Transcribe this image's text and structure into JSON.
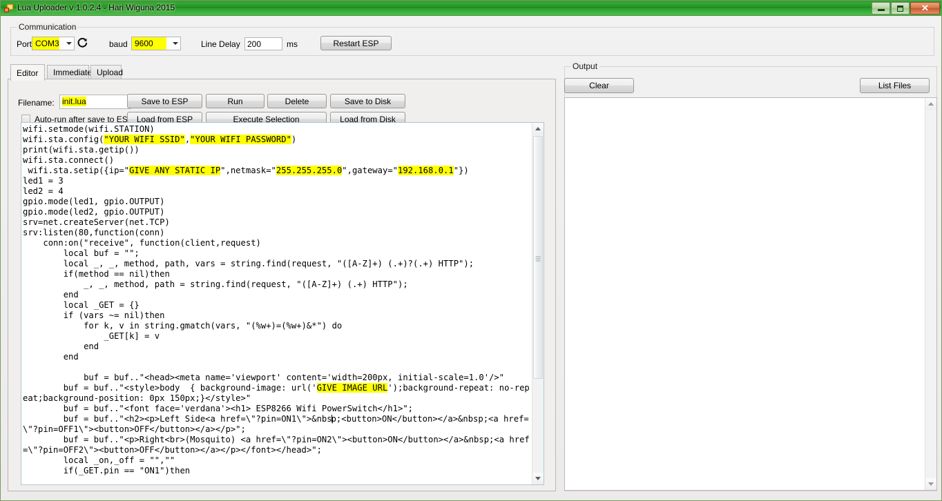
{
  "window": {
    "title": "Lua Uploader v 1.0.2.4 - Hari Wiguna 2015",
    "icon": "app-form-icon",
    "buttons": {
      "minimize": "minimize-icon",
      "maximize": "maximize-icon",
      "close": "✕"
    }
  },
  "colors": {
    "title_gradient_start": "#2f9e2f",
    "title_gradient_end": "#4fbd4f",
    "highlight": "#ffff00",
    "close_button": "#c6572c",
    "editor_border": "#a9c7d6",
    "panel_bg": "#f1efed"
  },
  "communication": {
    "group_label": "Communication",
    "port_label": "Port",
    "port_value": "COM3",
    "refresh_icon": "refresh-icon",
    "baud_label": "baud",
    "baud_value": "9600",
    "line_delay_label": "Line Delay",
    "line_delay_value": "200",
    "line_delay_unit": "ms",
    "restart_button": "Restart ESP"
  },
  "tabs": [
    {
      "label": "Editor",
      "active": true
    },
    {
      "label": "Immediate",
      "active": false
    },
    {
      "label": "Upload",
      "active": false
    }
  ],
  "editor_toolbar": {
    "filename_label": "Filename:",
    "filename_value": "init.lua",
    "autorun_label": "Auto-run after save to ESP",
    "autorun_checked": false,
    "buttons": {
      "save_to_esp": "Save to ESP",
      "run": "Run",
      "delete": "Delete",
      "save_to_disk": "Save to Disk",
      "load_from_esp": "Load from ESP",
      "execute_selection_mnemonic": "E",
      "execute_selection_rest": "xecute Selection",
      "load_from_disk": "Load from Disk"
    }
  },
  "output": {
    "group_label": "Output",
    "clear_button": "Clear",
    "list_files_button": "List Files",
    "content": ""
  },
  "code": {
    "lines": [
      [
        {
          "t": "wifi.setmode(wifi.STATION)"
        }
      ],
      [
        {
          "t": "wifi.sta.config("
        },
        {
          "t": "\"YOUR WIFI SSID\"",
          "h": true
        },
        {
          "t": ","
        },
        {
          "t": "\"YOUR WIFI PASSWORD\"",
          "h": true
        },
        {
          "t": ")"
        }
      ],
      [
        {
          "t": "print(wifi.sta.getip())"
        }
      ],
      [
        {
          "t": "wifi.sta.connect()"
        }
      ],
      [
        {
          "t": " wifi.sta.setip({ip=\""
        },
        {
          "t": "GIVE ANY STATIC IP",
          "h": true
        },
        {
          "t": "\",netmask=\""
        },
        {
          "t": "255.255.255.0",
          "h": true
        },
        {
          "t": "\",gateway=\""
        },
        {
          "t": "192.168.0.1",
          "h": true
        },
        {
          "t": "\"})"
        }
      ],
      [
        {
          "t": "led1 = 3"
        }
      ],
      [
        {
          "t": "led2 = 4"
        }
      ],
      [
        {
          "t": "gpio.mode(led1, gpio.OUTPUT)"
        }
      ],
      [
        {
          "t": "gpio.mode(led2, gpio.OUTPUT)"
        }
      ],
      [
        {
          "t": "srv=net.createServer(net.TCP)"
        }
      ],
      [
        {
          "t": "srv:listen(80,function(conn)"
        }
      ],
      [
        {
          "t": "    conn:on(\"receive\", function(client,request)"
        }
      ],
      [
        {
          "t": "        local buf = \"\";"
        }
      ],
      [
        {
          "t": "        local _, _, method, path, vars = string.find(request, \"([A-Z]+) (.+)?(.+) HTTP\");"
        }
      ],
      [
        {
          "t": "        if(method == nil)then"
        }
      ],
      [
        {
          "t": "            _, _, method, path = string.find(request, \"([A-Z]+) (.+) HTTP\");"
        }
      ],
      [
        {
          "t": "        end"
        }
      ],
      [
        {
          "t": "        local _GET = {}"
        }
      ],
      [
        {
          "t": "        if (vars ~= nil)then"
        }
      ],
      [
        {
          "t": "            for k, v in string.gmatch(vars, \"(%w+)=(%w+)&*\") do"
        }
      ],
      [
        {
          "t": "                _GET[k] = v"
        }
      ],
      [
        {
          "t": "            end"
        }
      ],
      [
        {
          "t": "        end"
        }
      ],
      [
        {
          "t": ""
        }
      ],
      [
        {
          "t": "            buf = buf..\"<head><meta name='viewport' content='width=200px, initial-scale=1.0'/>\""
        }
      ],
      [
        {
          "t": "        buf = buf..\"<style>body  { background-image: url('"
        },
        {
          "t": "GIVE IMAGE URL",
          "h": true
        },
        {
          "t": "');background-repeat: no-repeat;background-position: 0px 150px;}</style>\""
        }
      ],
      [
        {
          "t": "        buf = buf..\"<font face='verdana'><h1> ESP8266 Wifi PowerSwitch</h1>\";"
        }
      ],
      [
        {
          "t": "        buf = buf..\"<h2><p>Left Side<a href=\\\"?pin=ON1\\\">&nbs"
        },
        {
          "caret": true
        },
        {
          "t": "p;<button>ON</button></a>&nbsp;<a href=\\\"?pin=OFF1\\\"><button>OFF</button></a></p>\";"
        }
      ],
      [
        {
          "t": "        buf = buf..\"<p>Right<br>(Mosquito) <a href=\\\"?pin=ON2\\\"><button>ON</button></a>&nbsp;<a href=\\\"?pin=OFF2\\\"><button>OFF</button></a></p></font></head>\";"
        }
      ],
      [
        {
          "t": "        local _on,_off = \"\",\"\""
        }
      ],
      [
        {
          "t": "        if(_GET.pin == \"ON1\")then"
        }
      ]
    ]
  }
}
